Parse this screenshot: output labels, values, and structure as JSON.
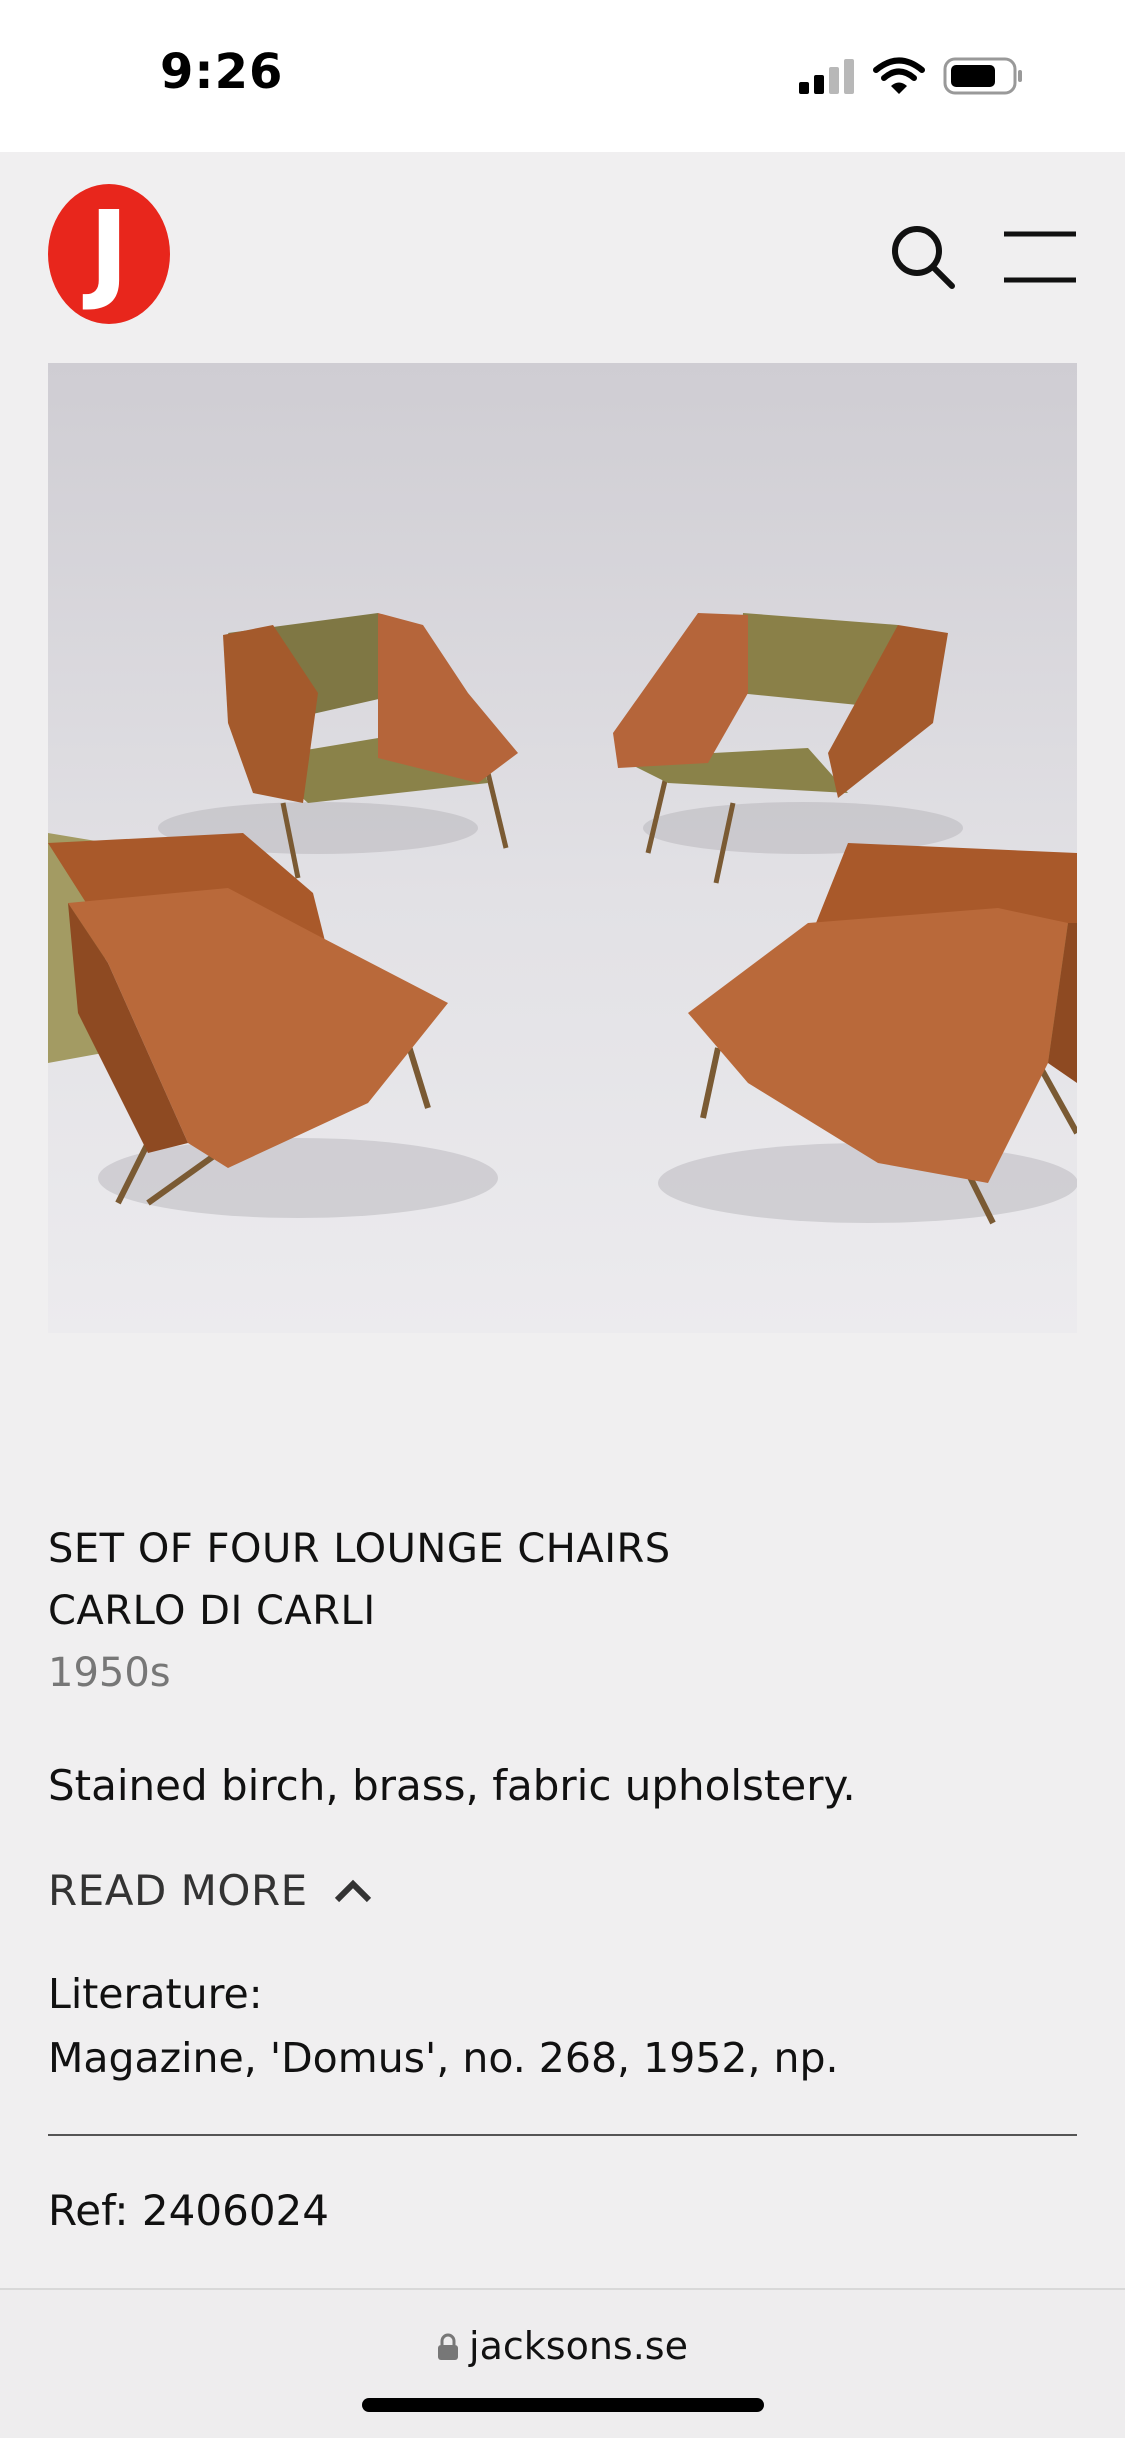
{
  "status_bar": {
    "time": "9:26"
  },
  "header": {
    "logo_letter": "J"
  },
  "hero": {
    "image_icon": "lounge-chairs-photo"
  },
  "product": {
    "title_line1": "SET OF FOUR LOUNGE CHAIRS",
    "title_line2": "CARLO DI CARLI",
    "date": "1950s",
    "description": "Stained birch, brass, fabric upholstery.",
    "read_more_label": "READ MORE",
    "literature_label": "Literature:",
    "literature_text": "Magazine, 'Domus', no. 268, 1952, np.",
    "ref": "Ref: 2406024"
  },
  "browser": {
    "url": "jacksons.se"
  },
  "colors": {
    "brand_red": "#e8261c",
    "background": "#f0eff0"
  }
}
